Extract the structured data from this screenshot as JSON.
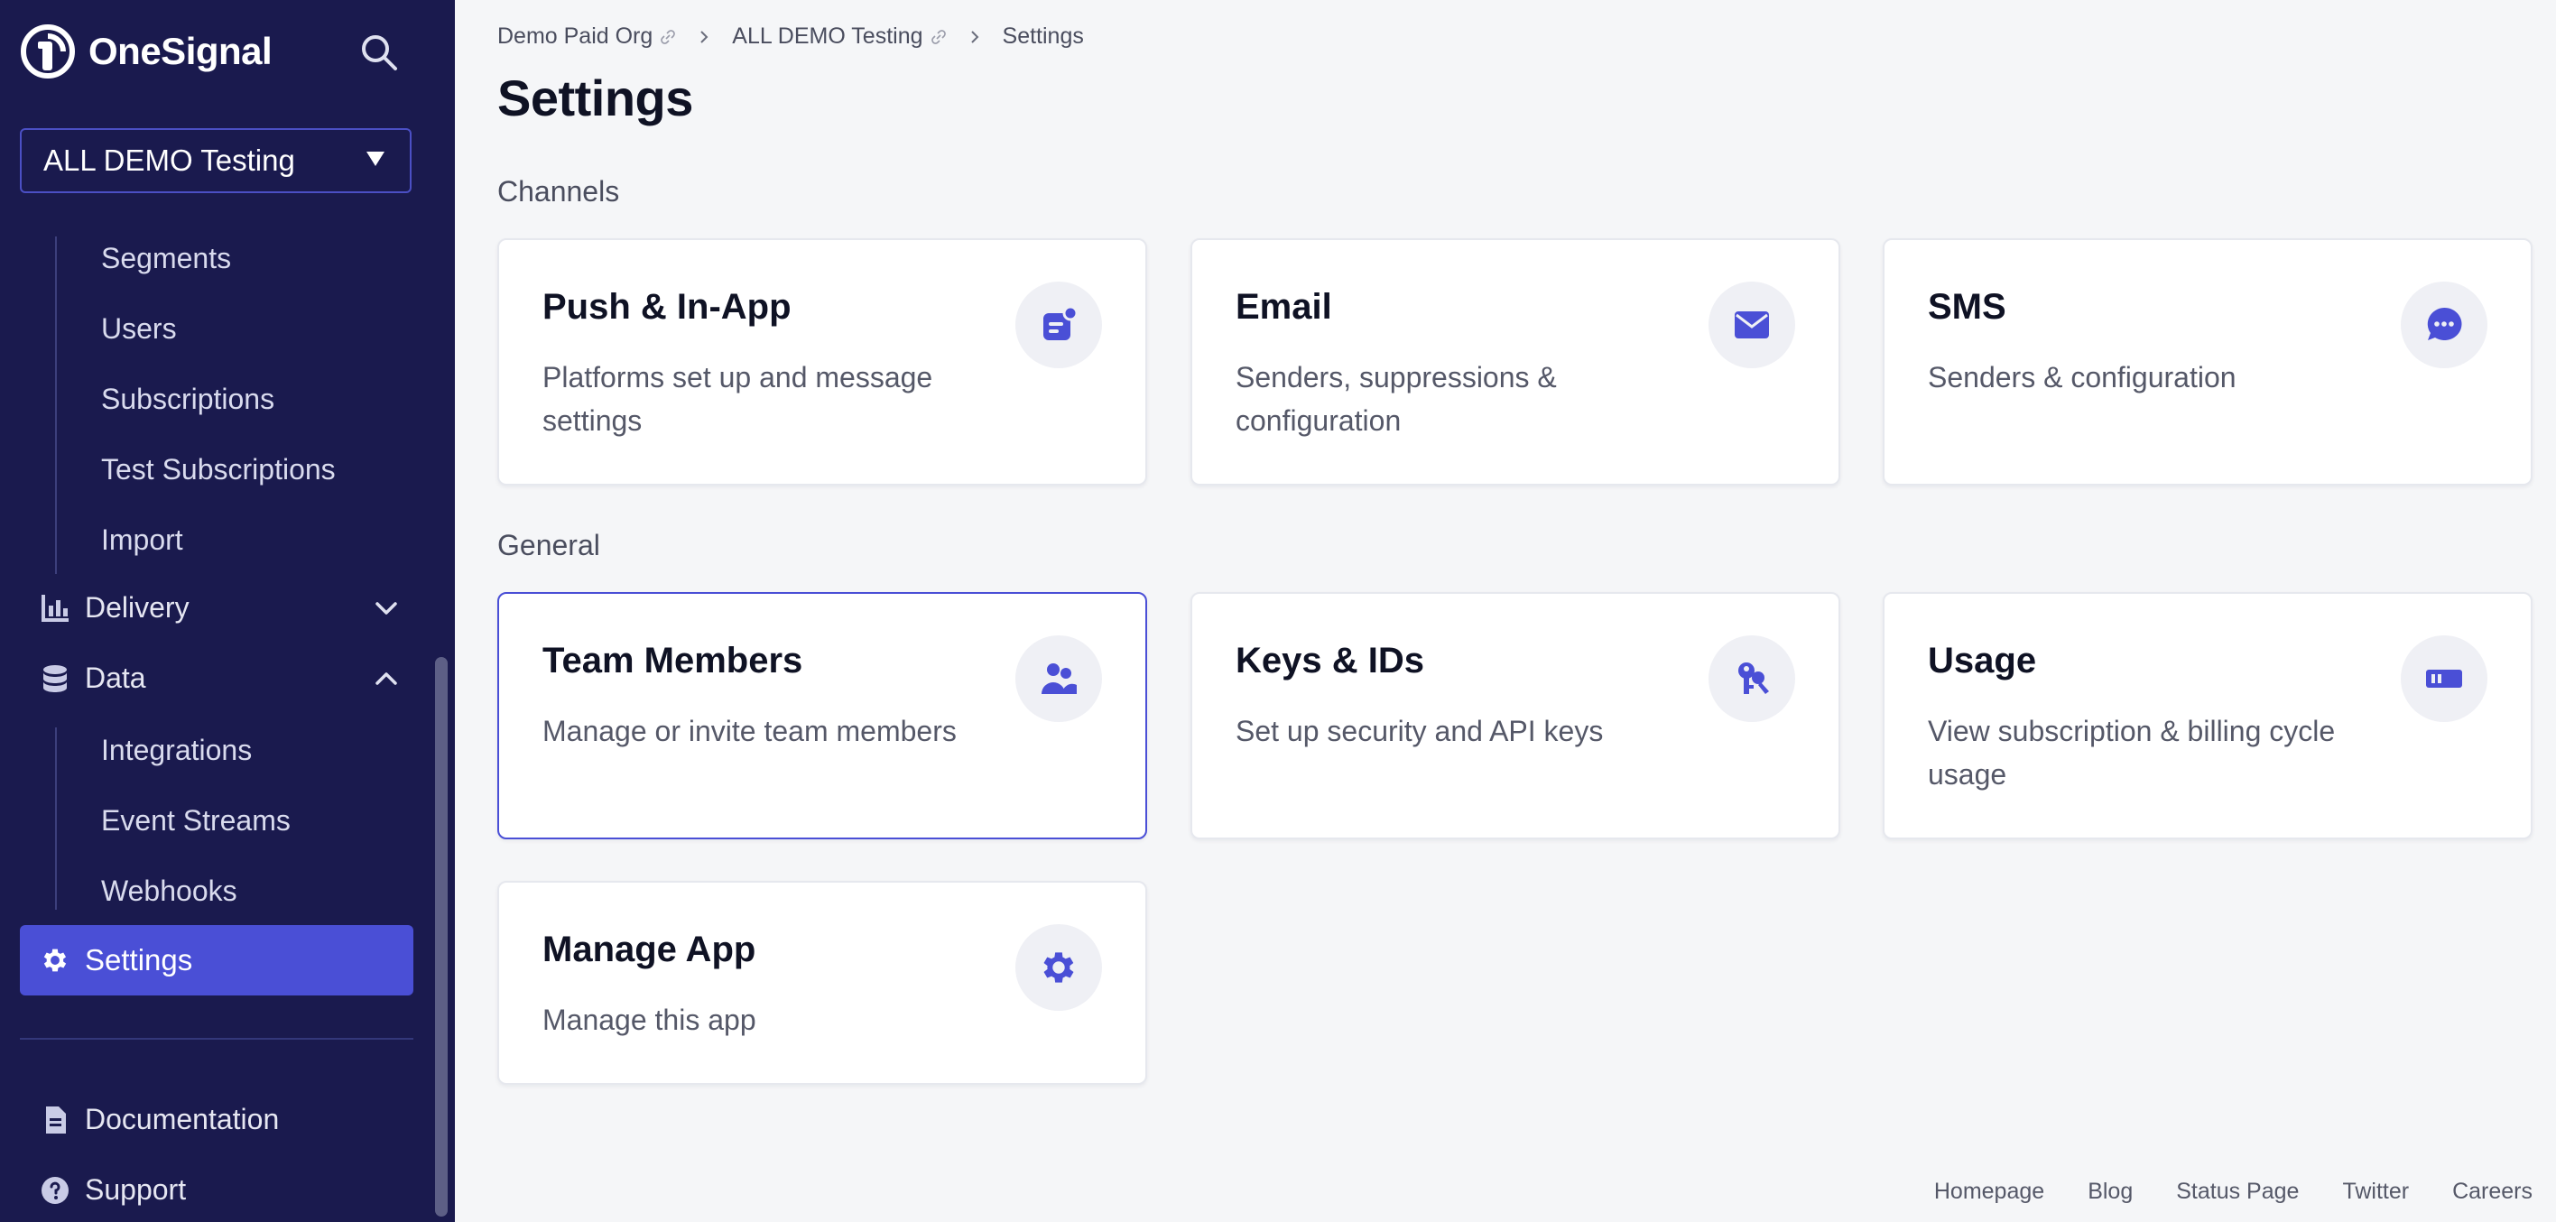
{
  "brand": {
    "name": "OneSignal",
    "accent": "#4a4fd6",
    "sidebar_bg": "#1a1a4e"
  },
  "app_selector": {
    "value": "ALL DEMO Testing"
  },
  "sidebar": {
    "audience_items": [
      {
        "label": "Segments"
      },
      {
        "label": "Users"
      },
      {
        "label": "Subscriptions"
      },
      {
        "label": "Test Subscriptions"
      },
      {
        "label": "Import"
      }
    ],
    "delivery": {
      "label": "Delivery",
      "icon": "bar-chart-icon",
      "expanded": false
    },
    "data": {
      "label": "Data",
      "icon": "database-icon",
      "expanded": true
    },
    "data_items": [
      {
        "label": "Integrations"
      },
      {
        "label": "Event Streams"
      },
      {
        "label": "Webhooks"
      }
    ],
    "settings": {
      "label": "Settings",
      "icon": "gear-icon",
      "active": true
    },
    "bottom": [
      {
        "label": "Documentation",
        "icon": "document-icon"
      },
      {
        "label": "Support",
        "icon": "help-icon"
      }
    ]
  },
  "breadcrumb": [
    {
      "label": "Demo Paid Org"
    },
    {
      "label": "ALL DEMO Testing"
    },
    {
      "label": "Settings"
    }
  ],
  "page_title": "Settings",
  "sections": {
    "channels": {
      "label": "Channels",
      "cards": [
        {
          "title": "Push & In-App",
          "description": "Platforms set up and message settings",
          "icon": "push-notification-icon"
        },
        {
          "title": "Email",
          "description": "Senders, suppressions & configuration",
          "icon": "envelope-icon"
        },
        {
          "title": "SMS",
          "description": "Senders & configuration",
          "icon": "chat-bubble-icon"
        }
      ]
    },
    "general": {
      "label": "General",
      "cards": [
        {
          "title": "Team Members",
          "description": "Manage or invite team members",
          "icon": "users-icon",
          "selected": true
        },
        {
          "title": "Keys & IDs",
          "description": "Set up security and API keys",
          "icon": "keys-icon"
        },
        {
          "title": "Usage",
          "description": "View subscription & billing cycle usage",
          "icon": "usage-meter-icon"
        },
        {
          "title": "Manage App",
          "description": "Manage this app",
          "icon": "gear-icon"
        }
      ]
    }
  },
  "footer": [
    {
      "label": "Homepage"
    },
    {
      "label": "Blog"
    },
    {
      "label": "Status Page"
    },
    {
      "label": "Twitter"
    },
    {
      "label": "Careers"
    }
  ]
}
